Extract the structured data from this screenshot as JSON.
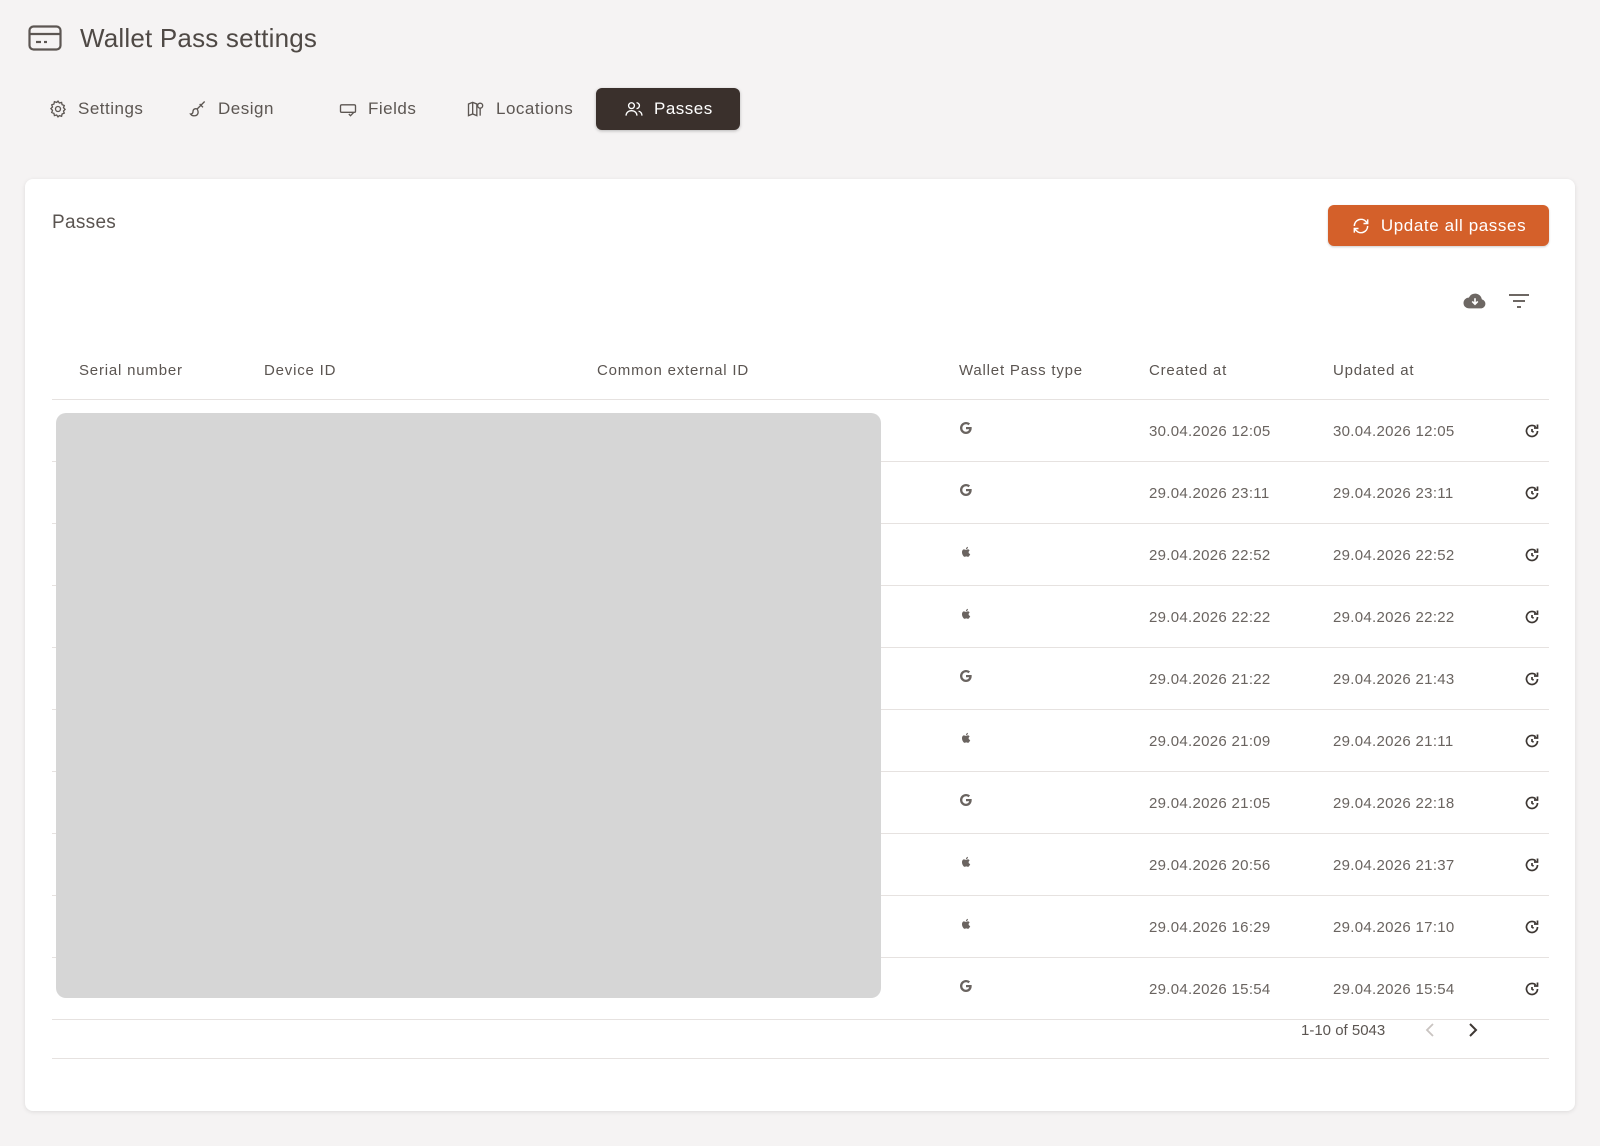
{
  "page": {
    "title": "Wallet Pass settings",
    "title_icon": "credit-card-icon"
  },
  "tabs": [
    {
      "label": "Settings",
      "icon": "gear-icon",
      "active": false
    },
    {
      "label": "Design",
      "icon": "brush-icon",
      "active": false
    },
    {
      "label": "Fields",
      "icon": "field-icon",
      "active": false
    },
    {
      "label": "Locations",
      "icon": "map-pin-icon",
      "active": false
    },
    {
      "label": "Passes",
      "icon": "users-icon",
      "active": true
    }
  ],
  "card": {
    "title": "Passes",
    "update_button": "Update all passes",
    "toolbar": [
      "cloud-download-icon",
      "filter-icon"
    ]
  },
  "table": {
    "columns": [
      "Serial number",
      "Device ID",
      "Common external ID",
      "Wallet Pass type",
      "Created at",
      "Updated at"
    ],
    "rows": [
      {
        "type": "google",
        "created": "30.04.2026 12:05",
        "updated": "30.04.2026 12:05"
      },
      {
        "type": "google",
        "created": "29.04.2026 23:11",
        "updated": "29.04.2026 23:11"
      },
      {
        "type": "apple",
        "created": "29.04.2026 22:52",
        "updated": "29.04.2026 22:52"
      },
      {
        "type": "apple",
        "created": "29.04.2026 22:22",
        "updated": "29.04.2026 22:22"
      },
      {
        "type": "google",
        "created": "29.04.2026 21:22",
        "updated": "29.04.2026 21:43"
      },
      {
        "type": "apple",
        "created": "29.04.2026 21:09",
        "updated": "29.04.2026 21:11"
      },
      {
        "type": "google",
        "created": "29.04.2026 21:05",
        "updated": "29.04.2026 22:18"
      },
      {
        "type": "apple",
        "created": "29.04.2026 20:56",
        "updated": "29.04.2026 21:37"
      },
      {
        "type": "apple",
        "created": "29.04.2026 16:29",
        "updated": "29.04.2026 17:10"
      },
      {
        "type": "google",
        "created": "29.04.2026 15:54",
        "updated": "29.04.2026 15:54"
      }
    ]
  },
  "pagination": {
    "range": "1-10 of 5043"
  },
  "colors": {
    "accent": "#d4602a",
    "active_tab": "#3a302c",
    "background": "#f5f3f3"
  }
}
